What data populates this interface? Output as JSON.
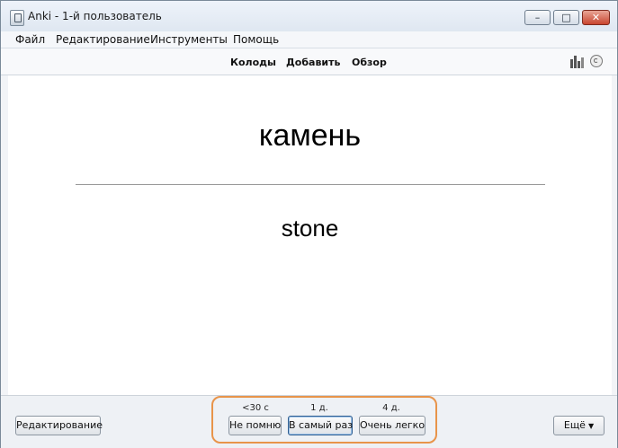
{
  "window": {
    "title": "Anki - 1-й пользователь"
  },
  "menu": [
    "Файл",
    "Редактирование",
    "Инструменты",
    "Помощь"
  ],
  "toolbar": {
    "links": [
      "Колоды",
      "Добавить",
      "Обзор"
    ]
  },
  "card": {
    "front": "камень",
    "back": "stone"
  },
  "bottom": {
    "edit_label": "Редактирование",
    "more_label": "Ещё",
    "answers": [
      {
        "interval": "<30 с",
        "label": "Не помню"
      },
      {
        "interval": "1 д.",
        "label": "В самый раз"
      },
      {
        "interval": "4 д.",
        "label": "Очень легко"
      }
    ]
  },
  "colors": {
    "highlight": "#e8944a",
    "close_button": "#c9452f"
  }
}
